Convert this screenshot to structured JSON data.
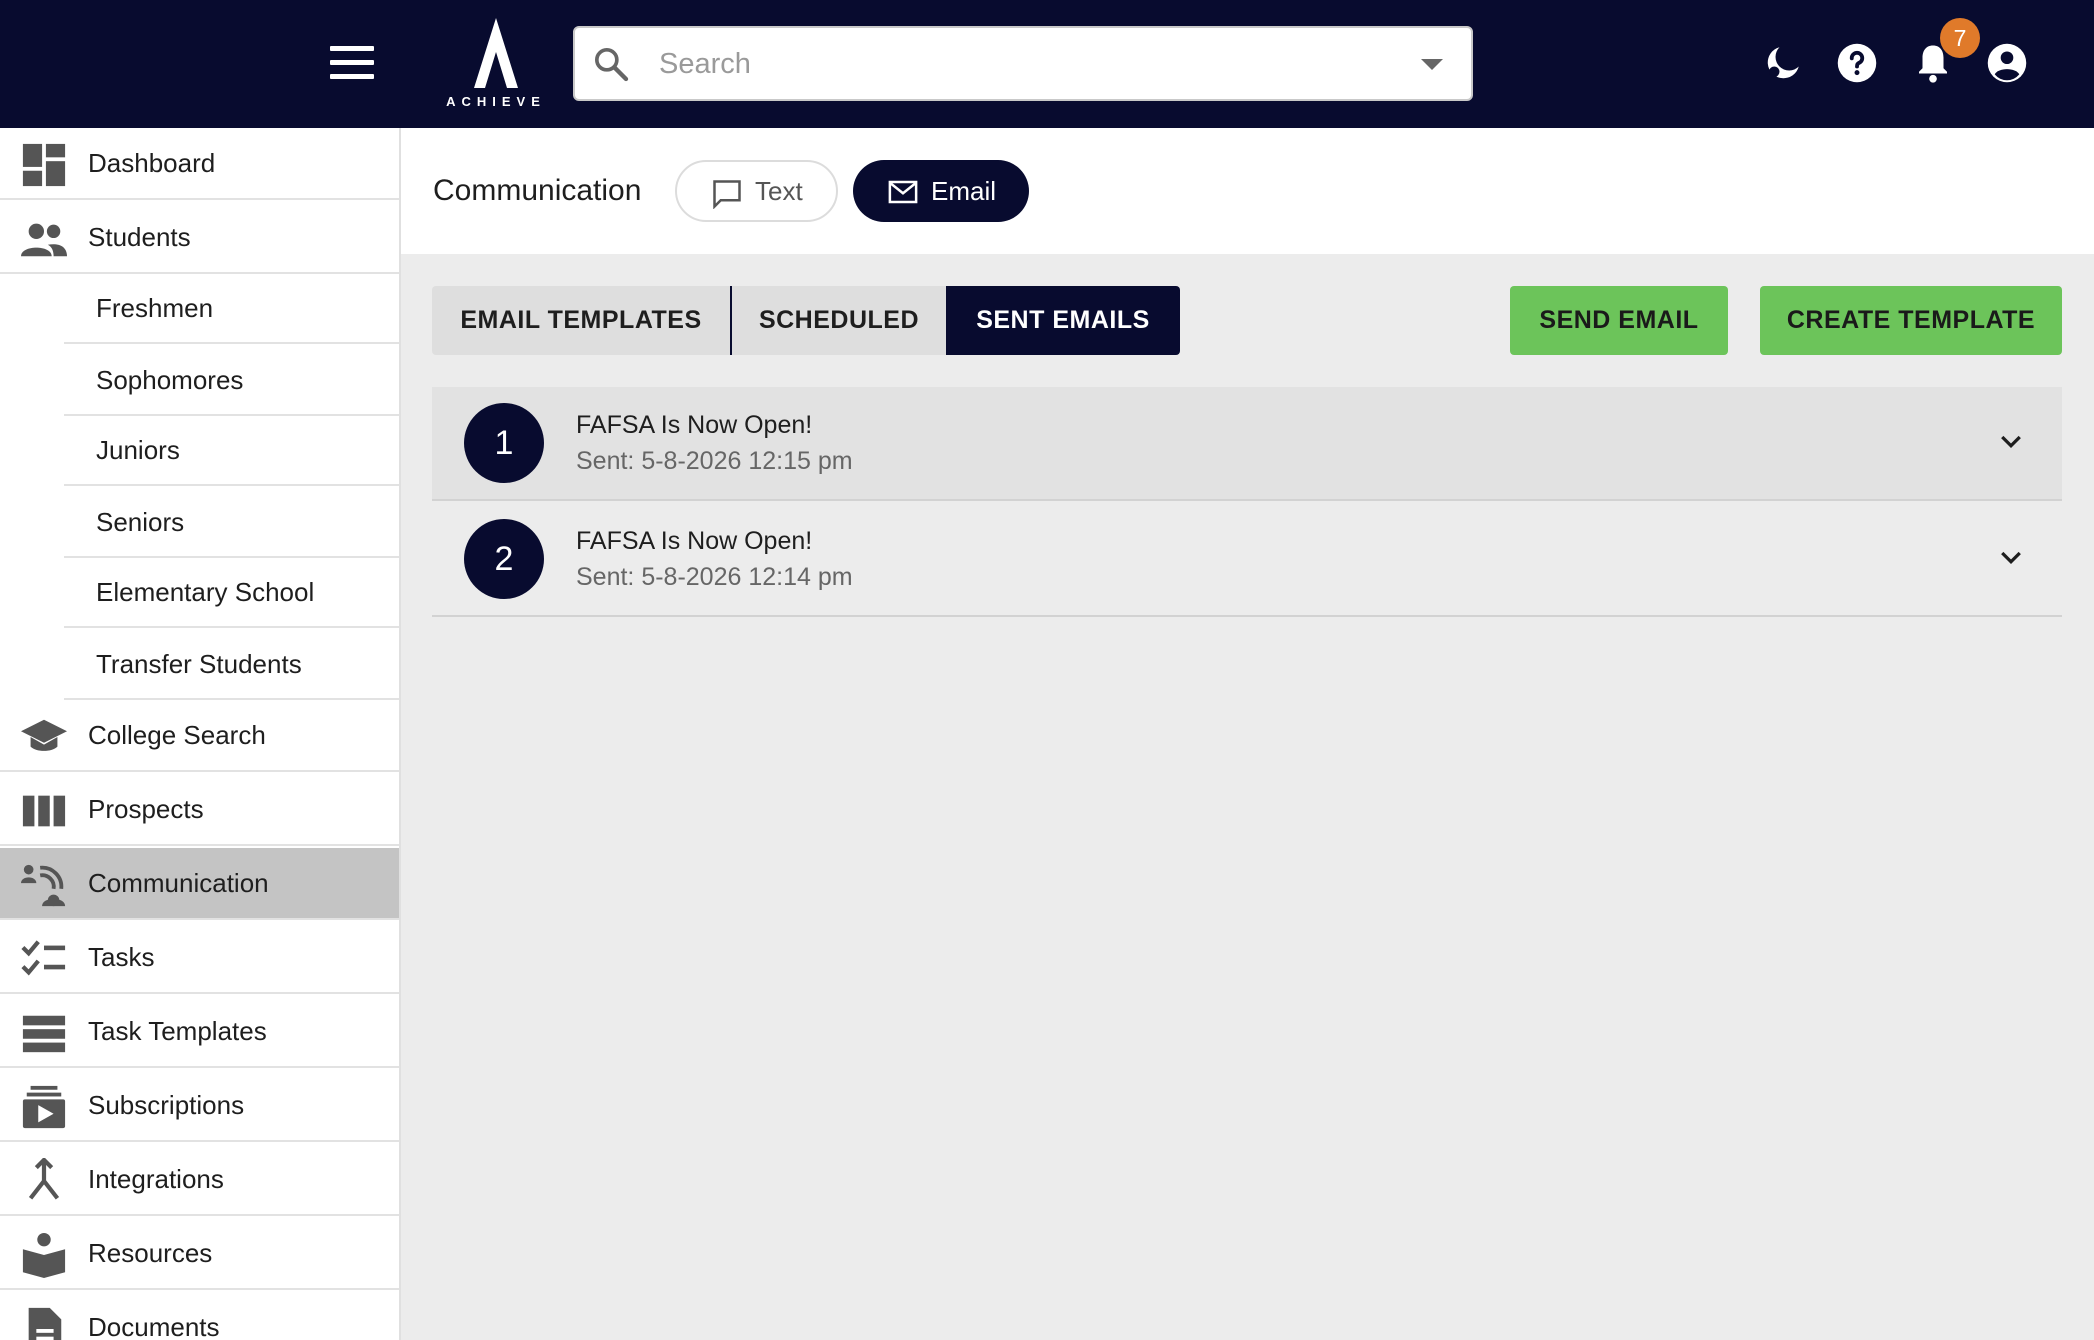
{
  "app": {
    "logo_text": "ACHIEVE",
    "search_placeholder": "Search",
    "notification_count": "7"
  },
  "sidebar": {
    "items": [
      {
        "label": "Dashboard",
        "icon": "dashboard-icon"
      },
      {
        "label": "Students",
        "icon": "people-icon"
      },
      {
        "label": "College Search",
        "icon": "graduation-cap-icon"
      },
      {
        "label": "Prospects",
        "icon": "columns-icon"
      },
      {
        "label": "Communication",
        "icon": "communication-icon"
      },
      {
        "label": "Tasks",
        "icon": "checklist-icon"
      },
      {
        "label": "Task Templates",
        "icon": "list-bars-icon"
      },
      {
        "label": "Subscriptions",
        "icon": "subscriptions-icon"
      },
      {
        "label": "Integrations",
        "icon": "merge-icon"
      },
      {
        "label": "Resources",
        "icon": "reader-icon"
      },
      {
        "label": "Documents",
        "icon": "document-icon"
      }
    ],
    "students_sub": [
      "Freshmen",
      "Sophomores",
      "Juniors",
      "Seniors",
      "Elementary School",
      "Transfer Students"
    ]
  },
  "header": {
    "title": "Communication",
    "text_pill": "Text",
    "email_pill": "Email"
  },
  "tabs": {
    "email_templates": "EMAIL TEMPLATES",
    "scheduled": "SCHEDULED",
    "sent_emails": "SENT EMAILS"
  },
  "actions": {
    "send_email": "SEND EMAIL",
    "create_template": "CREATE TEMPLATE"
  },
  "emails": [
    {
      "index": "1",
      "subject": "FAFSA Is Now Open!",
      "sent": "Sent: 5-8-2026 12:15 pm"
    },
    {
      "index": "2",
      "subject": "FAFSA Is Now Open!",
      "sent": "Sent: 5-8-2026 12:14 pm"
    }
  ],
  "colors": {
    "navy": "#080b2f",
    "green": "#6cc45a",
    "badge": "#e07a2a"
  }
}
